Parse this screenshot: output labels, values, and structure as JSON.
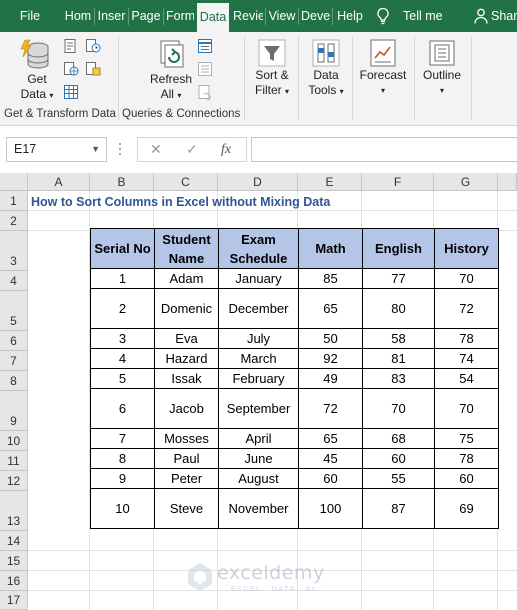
{
  "ribbon_tabs": {
    "file": "File",
    "home": "Hom",
    "insert": "Inser",
    "page": "Page",
    "formulas": "Form",
    "data": "Data",
    "review": "Revie",
    "view": "View",
    "developer": "Deve",
    "help": "Help",
    "tell_me": "Tell me",
    "share": "Share"
  },
  "ribbon": {
    "get_data_line1": "Get",
    "get_data_line2": "Data",
    "refresh_line1": "Refresh",
    "refresh_line2": "All",
    "sort_filter_line1": "Sort &",
    "sort_filter_line2": "Filter",
    "data_tools_line1": "Data",
    "data_tools_line2": "Tools",
    "forecast": "Forecast",
    "outline": "Outline",
    "group_get_transform": "Get & Transform Data",
    "group_queries": "Queries & Connections"
  },
  "formula_bar": {
    "name_box": "E17",
    "cancel_symbol": "✕",
    "enter_symbol": "✓",
    "fx_symbol": "fx",
    "formula": ""
  },
  "columns": [
    "A",
    "B",
    "C",
    "D",
    "E",
    "F",
    "G"
  ],
  "rows": [
    "1",
    "2",
    "3",
    "4",
    "5",
    "6",
    "7",
    "8",
    "9",
    "10",
    "11",
    "12",
    "13",
    "14",
    "15",
    "16",
    "17"
  ],
  "sheet": {
    "title": "How to Sort Columns in Excel without Mixing Data",
    "headers": [
      "Serial No",
      "Student Name",
      "Exam Schedule",
      "Math",
      "English",
      "History"
    ],
    "records": [
      [
        "1",
        "Adam",
        "January",
        "85",
        "77",
        "70"
      ],
      [
        "2",
        "Domenic",
        "December",
        "65",
        "80",
        "72"
      ],
      [
        "3",
        "Eva",
        "July",
        "50",
        "58",
        "78"
      ],
      [
        "4",
        "Hazard",
        "March",
        "92",
        "81",
        "74"
      ],
      [
        "5",
        "Issak",
        "February",
        "49",
        "83",
        "54"
      ],
      [
        "6",
        "Jacob",
        "September",
        "72",
        "70",
        "70"
      ],
      [
        "7",
        "Mosses",
        "April",
        "65",
        "68",
        "75"
      ],
      [
        "8",
        "Paul",
        "June",
        "45",
        "60",
        "78"
      ],
      [
        "9",
        "Peter",
        "August",
        "60",
        "55",
        "60"
      ],
      [
        "10",
        "Steve",
        "November",
        "100",
        "87",
        "69"
      ]
    ]
  },
  "watermark": {
    "name": "exceldemy",
    "tagline": "EXCEL · DATA · BI"
  },
  "colors": {
    "excel_green": "#217346",
    "header_fill": "#b4c6e7",
    "title_blue": "#2f5597"
  }
}
